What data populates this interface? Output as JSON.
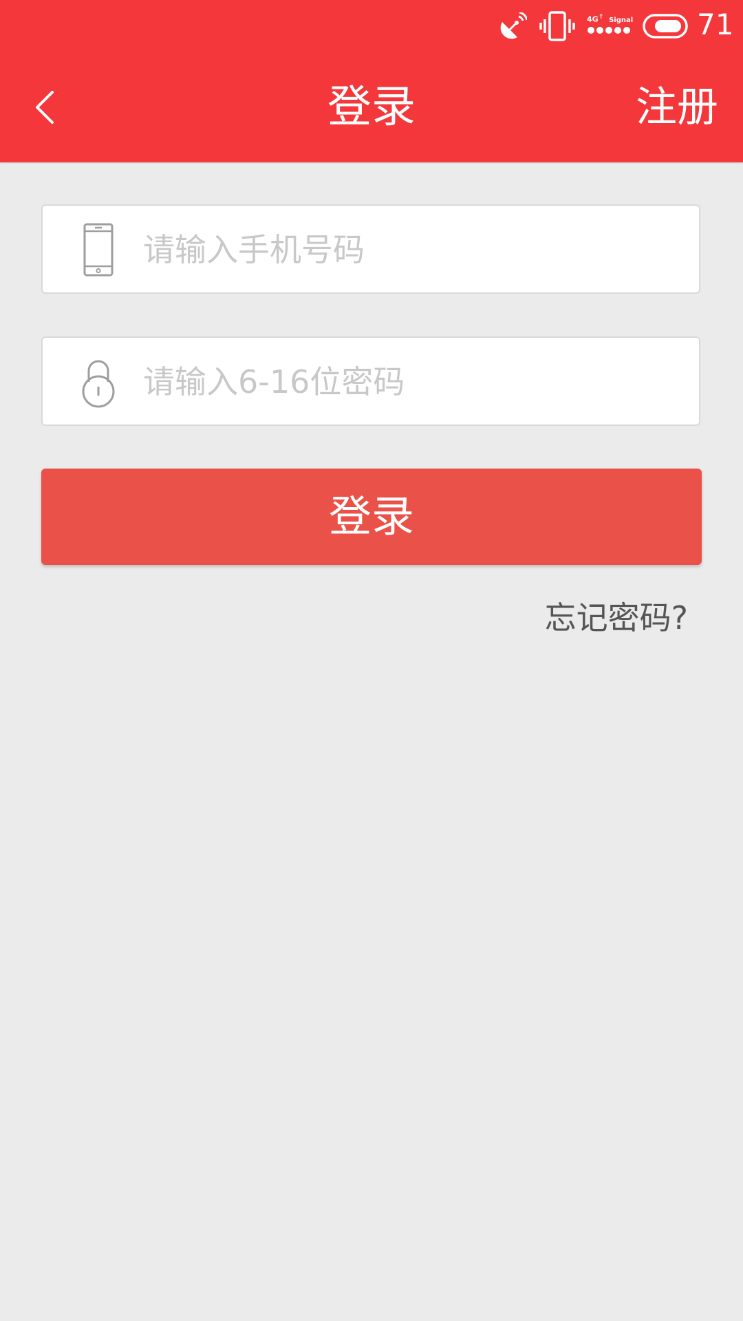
{
  "status_bar": {
    "signal_label": "4G",
    "signal_text": "Signal",
    "battery_level": "71",
    "icons": [
      "satellite-dish-icon",
      "vibrate-icon",
      "signal-strength-icon",
      "battery-icon"
    ]
  },
  "header": {
    "back_icon": "chevron-left-icon",
    "title": "登录",
    "register_label": "注册"
  },
  "form": {
    "phone": {
      "icon": "phone-icon",
      "placeholder": "请输入手机号码",
      "value": ""
    },
    "password": {
      "icon": "lock-icon",
      "placeholder": "请输入6-16位密码",
      "value": ""
    },
    "login_label": "登录",
    "forgot_label": "忘记密码?"
  },
  "colors": {
    "header_bg": "#f3373a",
    "button_bg": "#ea5148",
    "page_bg": "#ebebeb",
    "placeholder": "#c8c8c8"
  }
}
